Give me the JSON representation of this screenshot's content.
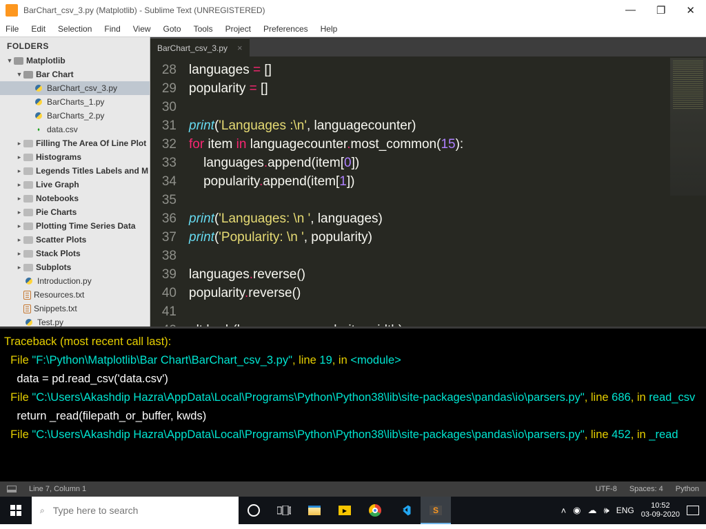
{
  "window": {
    "title": "BarChart_csv_3.py (Matplotlib) - Sublime Text (UNREGISTERED)"
  },
  "menu": [
    "File",
    "Edit",
    "Selection",
    "Find",
    "View",
    "Goto",
    "Tools",
    "Project",
    "Preferences",
    "Help"
  ],
  "sidebar": {
    "header": "FOLDERS",
    "root": "Matplotlib",
    "barchart": {
      "name": "Bar Chart",
      "files": [
        "BarChart_csv_3.py",
        "BarCharts_1.py",
        "BarCharts_2.py",
        "data.csv"
      ]
    },
    "folders": [
      "Filling The Area Of Line Plot",
      "Histograms",
      "Legends Titles Labels and M",
      "Live Graph",
      "Notebooks",
      "Pie Charts",
      "Plotting Time Series Data",
      "Scatter Plots",
      "Stack Plots",
      "Subplots"
    ],
    "loose": [
      "Introduction.py",
      "Resources.txt",
      "Snippets.txt",
      "Test.py"
    ]
  },
  "tab": {
    "name": "BarChart_csv_3.py"
  },
  "code": {
    "start": 28,
    "lines": [
      [
        [
          "id",
          "languages "
        ],
        [
          "op",
          "="
        ],
        [
          "id",
          " []"
        ]
      ],
      [
        [
          "id",
          "popularity "
        ],
        [
          "op",
          "="
        ],
        [
          "id",
          " []"
        ]
      ],
      [],
      [
        [
          "fn",
          "print"
        ],
        [
          "id",
          "("
        ],
        [
          "str",
          "'Languages :\\n'"
        ],
        [
          "id",
          ", languagecounter)"
        ]
      ],
      [
        [
          "kw",
          "for"
        ],
        [
          "id",
          " item "
        ],
        [
          "kw",
          "in"
        ],
        [
          "id",
          " languagecounter"
        ],
        [
          "op",
          "."
        ],
        [
          "id",
          "most_common("
        ],
        [
          "num",
          "15"
        ],
        [
          "id",
          "):"
        ]
      ],
      [
        [
          "id",
          "    languages"
        ],
        [
          "op",
          "."
        ],
        [
          "id",
          "append(item["
        ],
        [
          "num",
          "0"
        ],
        [
          "id",
          "])"
        ]
      ],
      [
        [
          "id",
          "    popularity"
        ],
        [
          "op",
          "."
        ],
        [
          "id",
          "append(item["
        ],
        [
          "num",
          "1"
        ],
        [
          "id",
          "])"
        ]
      ],
      [],
      [
        [
          "fn",
          "print"
        ],
        [
          "id",
          "("
        ],
        [
          "str",
          "'Languages: \\n '"
        ],
        [
          "id",
          ", languages)"
        ]
      ],
      [
        [
          "fn",
          "print"
        ],
        [
          "id",
          "("
        ],
        [
          "str",
          "'Popularity: \\n '"
        ],
        [
          "id",
          ", popularity)"
        ]
      ],
      [],
      [
        [
          "id",
          "languages"
        ],
        [
          "op",
          "."
        ],
        [
          "id",
          "reverse()"
        ]
      ],
      [
        [
          "id",
          "popularity"
        ],
        [
          "op",
          "."
        ],
        [
          "id",
          "reverse()"
        ]
      ],
      [],
      [
        [
          "id",
          "plt"
        ],
        [
          "op",
          "."
        ],
        [
          "id",
          "barh(languages, popularity, width)"
        ]
      ]
    ]
  },
  "console": [
    [
      [
        "gold",
        "Traceback (most recent call last):"
      ]
    ],
    [
      [
        "gold",
        "  File "
      ],
      [
        "cyan",
        "\"F:\\Python\\Matplotlib\\Bar Chart\\BarChart_csv_3.py\""
      ],
      [
        "gold",
        ", line "
      ],
      [
        "cyan",
        "19"
      ],
      [
        "gold",
        ", in "
      ],
      [
        "cyan",
        "<module>"
      ]
    ],
    [
      [
        "white",
        "    data = pd.read_csv('data.csv')"
      ]
    ],
    [
      [
        "gold",
        "  File "
      ],
      [
        "cyan",
        "\"C:\\Users\\Akashdip Hazra\\AppData\\Local\\Programs\\Python\\Python38\\lib\\site-packages\\pandas\\io\\parsers.py\""
      ],
      [
        "gold",
        ", line "
      ],
      [
        "cyan",
        "686"
      ],
      [
        "gold",
        ", in "
      ],
      [
        "cyan",
        "read_csv"
      ]
    ],
    [
      [
        "white",
        "    return _read(filepath_or_buffer, kwds)"
      ]
    ],
    [
      [
        "gold",
        "  File "
      ],
      [
        "cyan",
        "\"C:\\Users\\Akashdip Hazra\\AppData\\Local\\Programs\\Python\\Python38\\lib\\site-packages\\pandas\\io\\parsers.py\""
      ],
      [
        "gold",
        ", line "
      ],
      [
        "cyan",
        "452"
      ],
      [
        "gold",
        ", in "
      ],
      [
        "cyan",
        "_read"
      ]
    ]
  ],
  "status": {
    "pos": "Line 7, Column 1",
    "enc": "UTF-8",
    "indent": "Spaces: 4",
    "lang": "Python"
  },
  "taskbar": {
    "search_placeholder": "Type here to search",
    "lang": "ENG",
    "time": "10:52",
    "date": "03-09-2020"
  }
}
